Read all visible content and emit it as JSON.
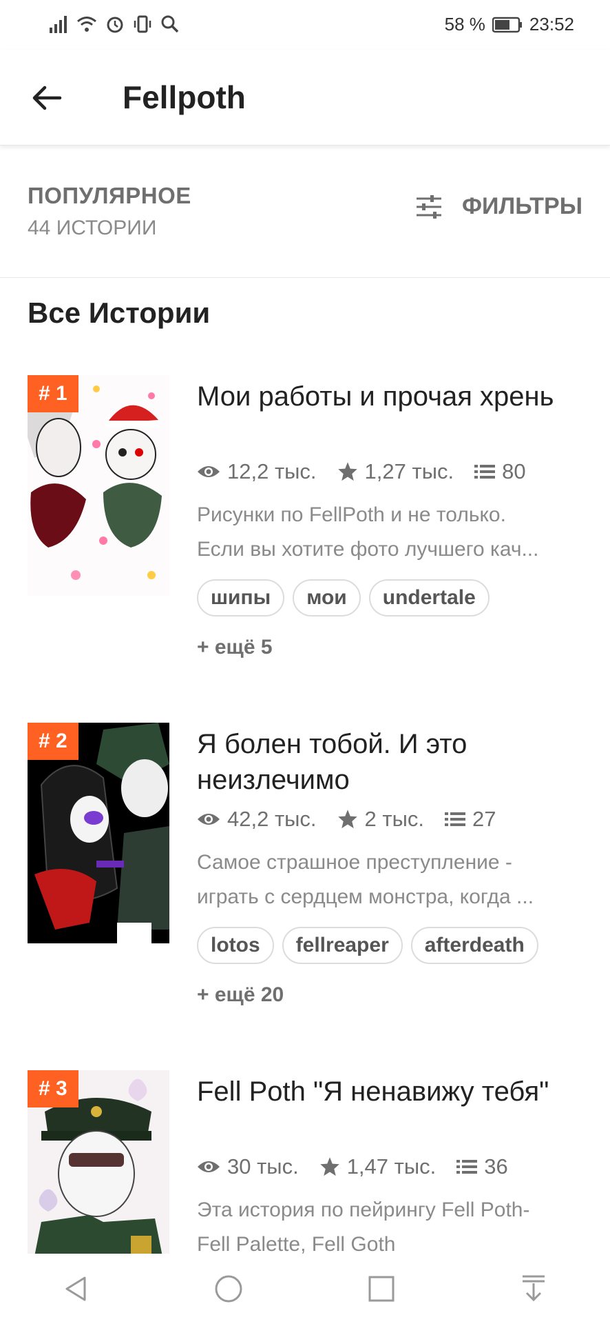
{
  "status_bar": {
    "battery": "58 %",
    "time": "23:52"
  },
  "app_bar": {
    "title": "Fellpoth"
  },
  "sort": {
    "label": "ПОПУЛЯРНОЕ",
    "count": "44 ИСТОРИИ",
    "filter_label": "ФИЛЬТРЫ"
  },
  "section": {
    "title": "Все Истории"
  },
  "stories": [
    {
      "rank": "# 1",
      "title": " Мои работы и прочая хрень",
      "reads": "12,2 тыс.",
      "votes": "1,27 тыс.",
      "parts": "80",
      "desc_line1": "Рисунки по FellPoth и не только.",
      "desc_line2": "Если вы хотите фото лучшего кач...",
      "tags": [
        "шипы",
        "мои",
        "undertale"
      ],
      "more": "+ ещё 5"
    },
    {
      "rank": "# 2",
      "title": "Я болен тобой. И это неизлечимо",
      "reads": "42,2 тыс.",
      "votes": "2 тыс.",
      "parts": "27",
      "desc_line1": "Самое страшное преступление -",
      "desc_line2": "играть с сердцем монстра, когда ...",
      "tags": [
        "lotos",
        "fellreaper",
        "afterdeath"
      ],
      "more": "+ ещё 20"
    },
    {
      "rank": "# 3",
      "title": "Fell Poth \"Я ненавижу тебя\"",
      "reads": "30 тыс.",
      "votes": "1,47 тыс.",
      "parts": "36",
      "desc_line1": "Эта история по пейрингу Fell Poth-",
      "desc_line2": "Fell Palette, Fell Goth"
    }
  ]
}
